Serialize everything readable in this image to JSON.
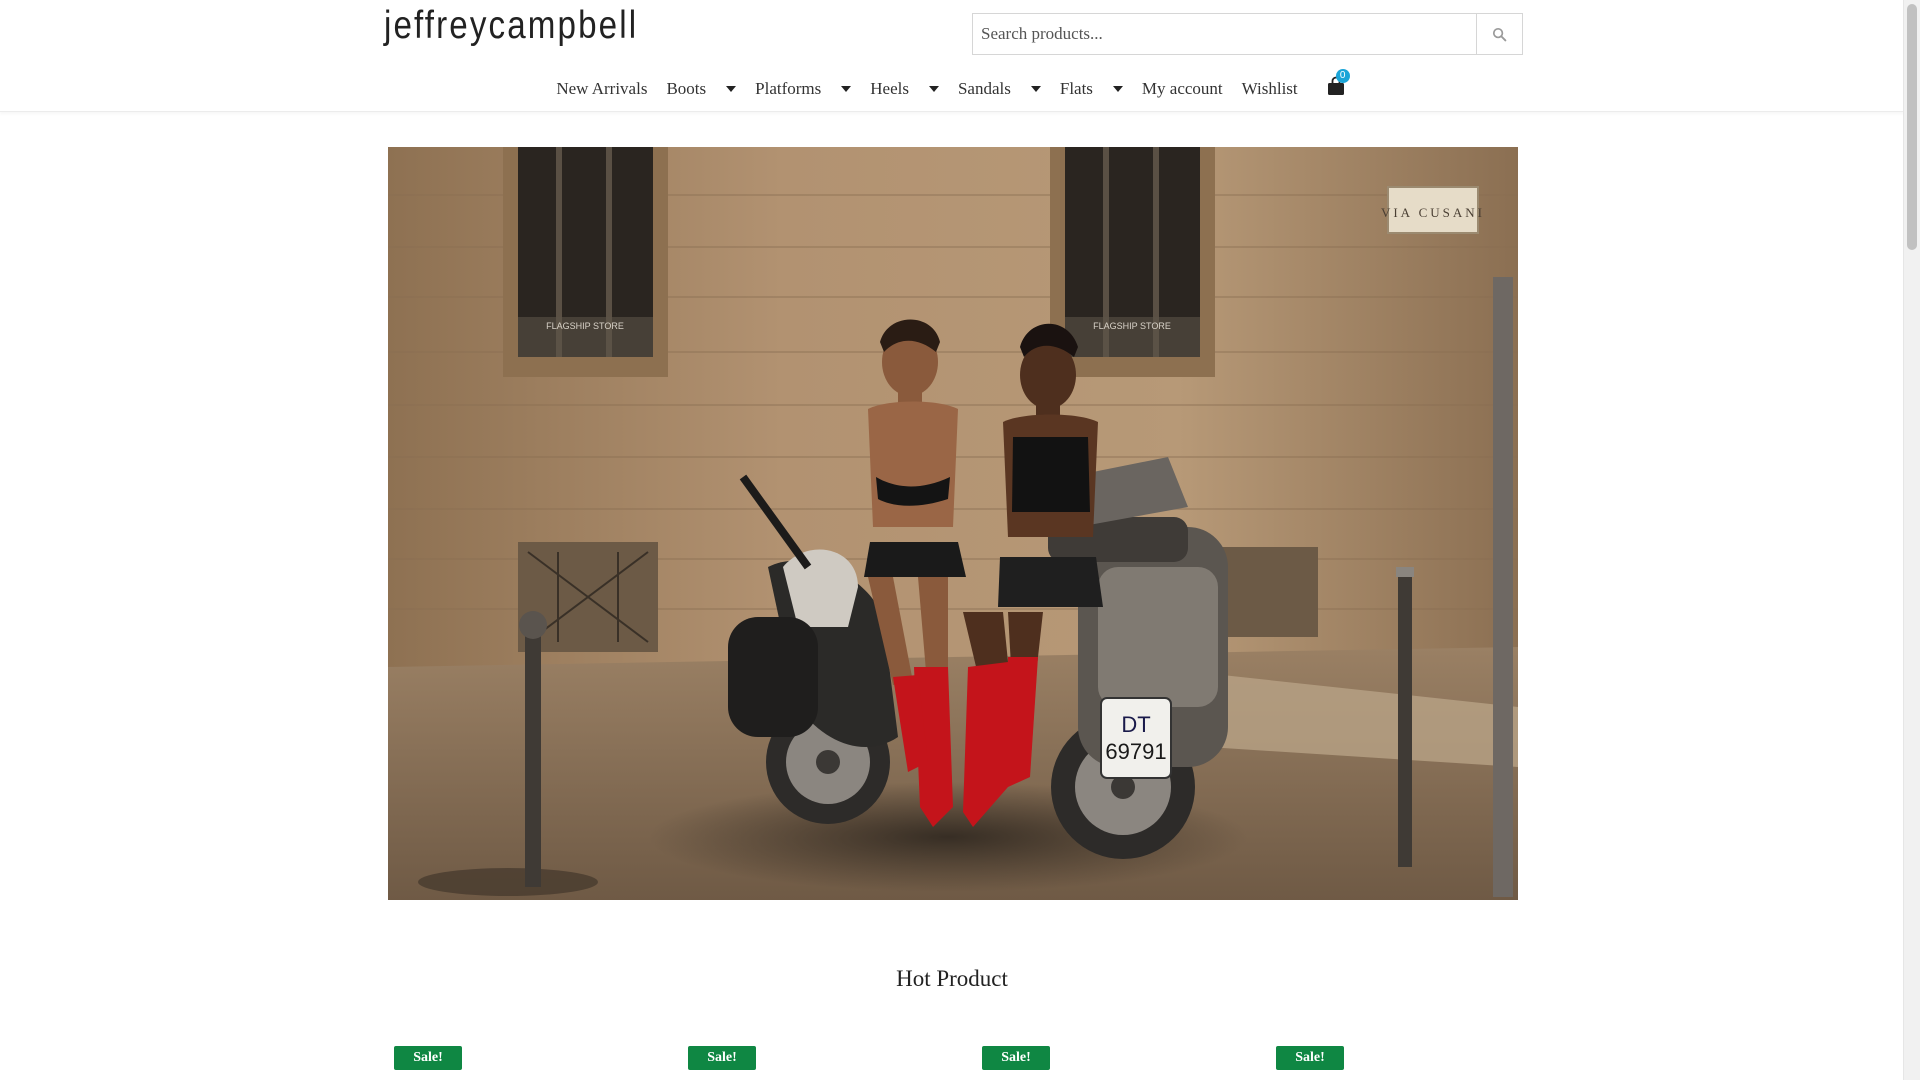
{
  "header": {
    "logo_text": "jeffreycampbell",
    "search": {
      "placeholder": "Search products..."
    }
  },
  "nav": {
    "items": [
      {
        "label": "New Arrivals",
        "has_dropdown": false
      },
      {
        "label": "Boots",
        "has_dropdown": true
      },
      {
        "label": "Platforms",
        "has_dropdown": true
      },
      {
        "label": "Heels",
        "has_dropdown": true
      },
      {
        "label": "Sandals",
        "has_dropdown": true
      },
      {
        "label": "Flats",
        "has_dropdown": true
      },
      {
        "label": "My account",
        "has_dropdown": false
      },
      {
        "label": "Wishlist",
        "has_dropdown": false
      }
    ],
    "cart_count": "0"
  },
  "hero": {
    "image": "Two models posing on scooters in front of stone building, red knee-high boots",
    "wall_sign": "VIA CUSANI",
    "window_text_left": "FLAGSHIP STORE",
    "window_text_right": "FLAGSHIP STORE",
    "plate_top": "DT",
    "plate_bottom": "69791"
  },
  "section": {
    "title": "Hot Product"
  },
  "products": [
    {
      "badge": "Sale!"
    },
    {
      "badge": "Sale!"
    },
    {
      "badge": "Sale!"
    },
    {
      "badge": "Sale!"
    }
  ],
  "colors": {
    "sale_badge": "#0f8743",
    "cart_badge": "#1ba5d8",
    "text": "#222222"
  },
  "icons": {
    "search": "search-icon",
    "cart": "shopping-bag-icon",
    "dropdown": "caret-down-icon"
  }
}
